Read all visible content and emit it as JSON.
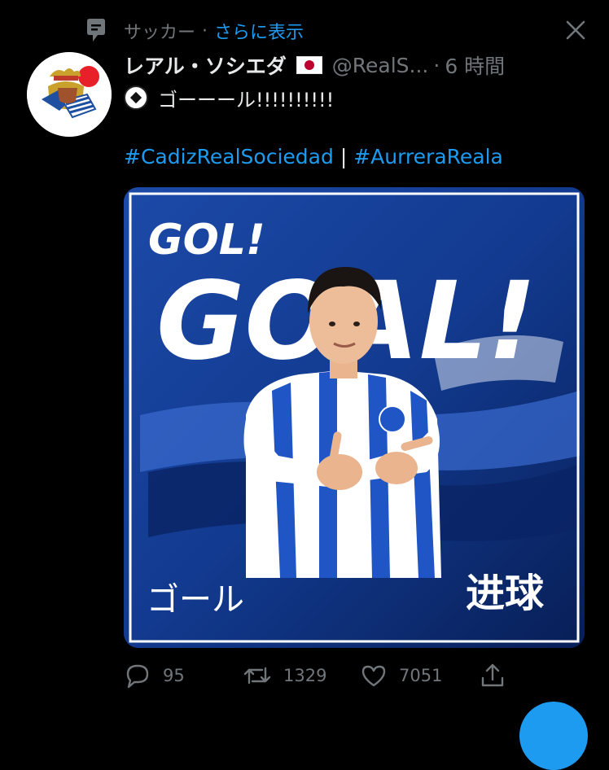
{
  "topic": {
    "label": "サッカー",
    "separator": "·",
    "more_label": "さらに表示",
    "icon": "topic-tag-icon"
  },
  "close_icon": "close-icon",
  "tweet": {
    "display_name": "レアル・ソシエダ",
    "flag": "japan-flag-icon",
    "handle": "@RealS...",
    "separator": "·",
    "time": "6 時間",
    "emoji": "soccer-ball-icon",
    "text": "ゴーーール!!!!!!!!!!",
    "hashtags": [
      "#CadizRealSociedad",
      "#AurreraReala"
    ],
    "hashtag_separator": "|"
  },
  "media": {
    "headline_small": "GOL!",
    "headline_large": "GOAL!",
    "caption_left": "ゴール",
    "caption_right": "进球",
    "colors": {
      "deep_blue": "#0b2a6e",
      "royal_blue": "#1d4fb8",
      "white": "#ffffff"
    }
  },
  "actions": {
    "reply_count": "95",
    "retweet_count": "1329",
    "like_count": "7051"
  },
  "accent_color": "#1d9bf0"
}
